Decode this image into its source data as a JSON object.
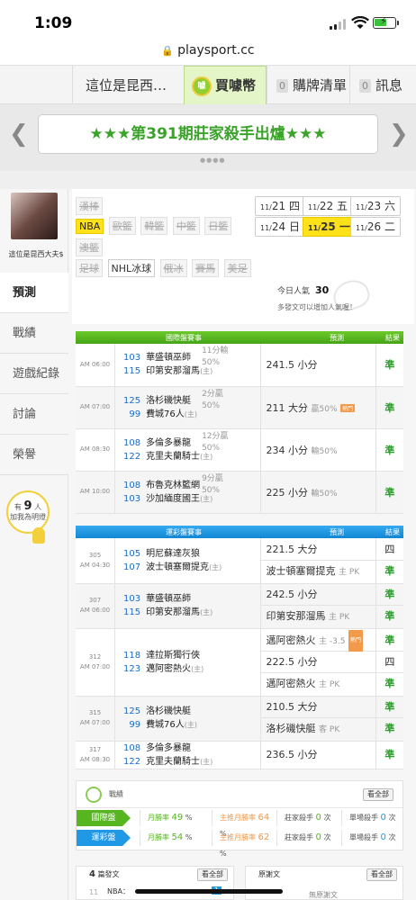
{
  "status": {
    "time": "1:09"
  },
  "url": "playsport.cc",
  "nav": {
    "user": "這位是昆西…",
    "buy": "買噱幣",
    "coin_glyph": "噱",
    "cart_count": "0",
    "cart": "購牌清單",
    "msg_count": "0",
    "msg": "訊息"
  },
  "banner": {
    "text": "★★★第391期莊家殺手出爐★★★",
    "dots": "●●●●"
  },
  "profile": {
    "name": "這位是昆西大夫$"
  },
  "sidebar": {
    "tabs": [
      "預測",
      "戰績",
      "遊戲紀錄",
      "討論",
      "榮譽"
    ]
  },
  "fans": {
    "prefix": "有",
    "count": "9",
    "unit": "人",
    "suffix": "加我為明燈"
  },
  "leagues": {
    "row1": [
      "漢棒"
    ],
    "row2": [
      "NBA",
      "歐籃",
      "韓籃",
      "中籃",
      "日籃"
    ],
    "row3": [
      "澳籃"
    ],
    "row4": [
      "足球",
      "NHL冰球",
      "俄冰",
      "賽馬",
      "美足"
    ]
  },
  "dates": [
    {
      "md": "11/",
      "d": "21",
      "w": "四"
    },
    {
      "md": "11/",
      "d": "22",
      "w": "五"
    },
    {
      "md": "11/",
      "d": "23",
      "w": "六"
    },
    {
      "md": "11/",
      "d": "24",
      "w": "日"
    },
    {
      "md": "11/",
      "d": "25",
      "w": "一"
    },
    {
      "md": "11/",
      "d": "26",
      "w": "二"
    }
  ],
  "popularity": {
    "label": "今日人氣",
    "value": "30",
    "note": "多發文可以增加人氣喔！"
  },
  "intl": {
    "header": {
      "match": "國際盤賽事",
      "pred": "預測",
      "result": "結果"
    },
    "rows": [
      {
        "time": "AM 06:00",
        "n1": "103",
        "t1": "華盛頓巫師",
        "n2": "115",
        "t2": "印第安那溜馬",
        "home2": "(主)",
        "hcp1": "",
        "hcp2": "11分輸",
        "hcp3": "50%",
        "pick": "241.5 小分",
        "res": "",
        "hot": "",
        "result": "準"
      },
      {
        "time": "AM 07:00",
        "n1": "125",
        "t1": "洛杉磯快艇",
        "n2": "99",
        "t2": "費城76人",
        "home2": "(主)",
        "hcp1": "2分贏",
        "hcp2": "50%",
        "hcp3": "",
        "pick": "211 大分",
        "res": "贏50%",
        "hot": "熱門",
        "result": "準"
      },
      {
        "time": "AM 08:30",
        "n1": "108",
        "t1": "多倫多暴龍",
        "n2": "122",
        "t2": "克里夫蘭騎士",
        "home2": "(主)",
        "hcp1": "",
        "hcp2": "12分贏",
        "hcp3": "50%",
        "pick": "234 小分",
        "res": "輸50%",
        "hot": "",
        "result": "準"
      },
      {
        "time": "AM 10:00",
        "n1": "108",
        "t1": "布魯克林籃網",
        "n2": "103",
        "t2": "沙加緬度國王",
        "home2": "(主)",
        "hcp1": "",
        "hcp2": "9分贏",
        "hcp3": "50%",
        "pick": "225 小分",
        "res": "輸50%",
        "hot": "",
        "result": "準"
      }
    ]
  },
  "lottery": {
    "header": {
      "match": "運彩盤賽事",
      "pred": "預測",
      "result": "結果"
    },
    "rows": [
      {
        "code": "305",
        "time": "AM 04:30",
        "n1": "105",
        "t1": "明尼蘇達灰狼",
        "n2": "107",
        "t2": "波士頓塞爾提克",
        "home2": "(主)",
        "picks": [
          {
            "text": "221.5 大分",
            "sub": "",
            "hot": "",
            "result": "四"
          },
          {
            "text": "波士頓塞爾提克",
            "sub": "主 PK",
            "hot": "",
            "result": "準"
          }
        ]
      },
      {
        "code": "307",
        "time": "AM 06:00",
        "n1": "103",
        "t1": "華盛頓巫師",
        "n2": "115",
        "t2": "印第安那溜馬",
        "home2": "(主)",
        "picks": [
          {
            "text": "242.5 小分",
            "sub": "",
            "hot": "",
            "result": "準"
          },
          {
            "text": "印第安那溜馬",
            "sub": "主 PK",
            "hot": "",
            "result": "準"
          }
        ]
      },
      {
        "code": "312",
        "time": "AM 07:00",
        "n1": "118",
        "t1": "達拉斯獨行俠",
        "n2": "123",
        "t2": "邁阿密熱火",
        "home2": "(主)",
        "picks": [
          {
            "text": "邁阿密熱火",
            "sub": "主 -3.5",
            "hot": "熱門",
            "result": "準"
          },
          {
            "text": "222.5 小分",
            "sub": "",
            "hot": "",
            "result": "四"
          },
          {
            "text": "邁阿密熱火",
            "sub": "主 PK",
            "hot": "",
            "result": "準"
          }
        ]
      },
      {
        "code": "315",
        "time": "AM 07:00",
        "n1": "125",
        "t1": "洛杉磯快艇",
        "n2": "99",
        "t2": "費城76人",
        "home2": "(主)",
        "picks": [
          {
            "text": "210.5 大分",
            "sub": "",
            "hot": "",
            "result": "準"
          },
          {
            "text": "洛杉磯快艇",
            "sub": "客 PK",
            "hot": "",
            "result": "準"
          }
        ]
      },
      {
        "code": "317",
        "time": "AM 08:30",
        "n1": "108",
        "t1": "多倫多暴龍",
        "n2": "122",
        "t2": "克里夫蘭騎士",
        "home2": "(主)",
        "picks": [
          {
            "text": "236.5 小分",
            "sub": "",
            "hot": "",
            "result": "準"
          }
        ]
      }
    ]
  },
  "record": {
    "title": "戰績",
    "see_all": "看全部",
    "rows": [
      {
        "label": "國際盤",
        "color": "#57b51f",
        "m_label": "月勝率",
        "m_val": "49",
        "m_unit": "%",
        "h_label": "主推月勝率",
        "h_val": "64",
        "h_unit": "%",
        "k_label": "莊家殺手",
        "k_val": "0",
        "k_unit": "次",
        "s_label": "單場殺手",
        "s_val": "0",
        "s_unit": "次"
      },
      {
        "label": "運彩盤",
        "color": "#1f98e6",
        "m_label": "月勝率",
        "m_val": "54",
        "m_unit": "%",
        "h_label": "主推月勝率",
        "h_val": "62",
        "h_unit": "%",
        "k_label": "莊家殺手",
        "k_val": "0",
        "k_unit": "次",
        "s_label": "單場殺手",
        "s_val": "0",
        "s_unit": "次"
      }
    ]
  },
  "posts": {
    "count": "4",
    "title": "篇發文",
    "see_all": "看全部",
    "item_num": "11",
    "item_text": "NBA：",
    "page": "1"
  },
  "replies": {
    "title": "原謝文",
    "see_all": "看全部",
    "empty": "無原謝文"
  }
}
